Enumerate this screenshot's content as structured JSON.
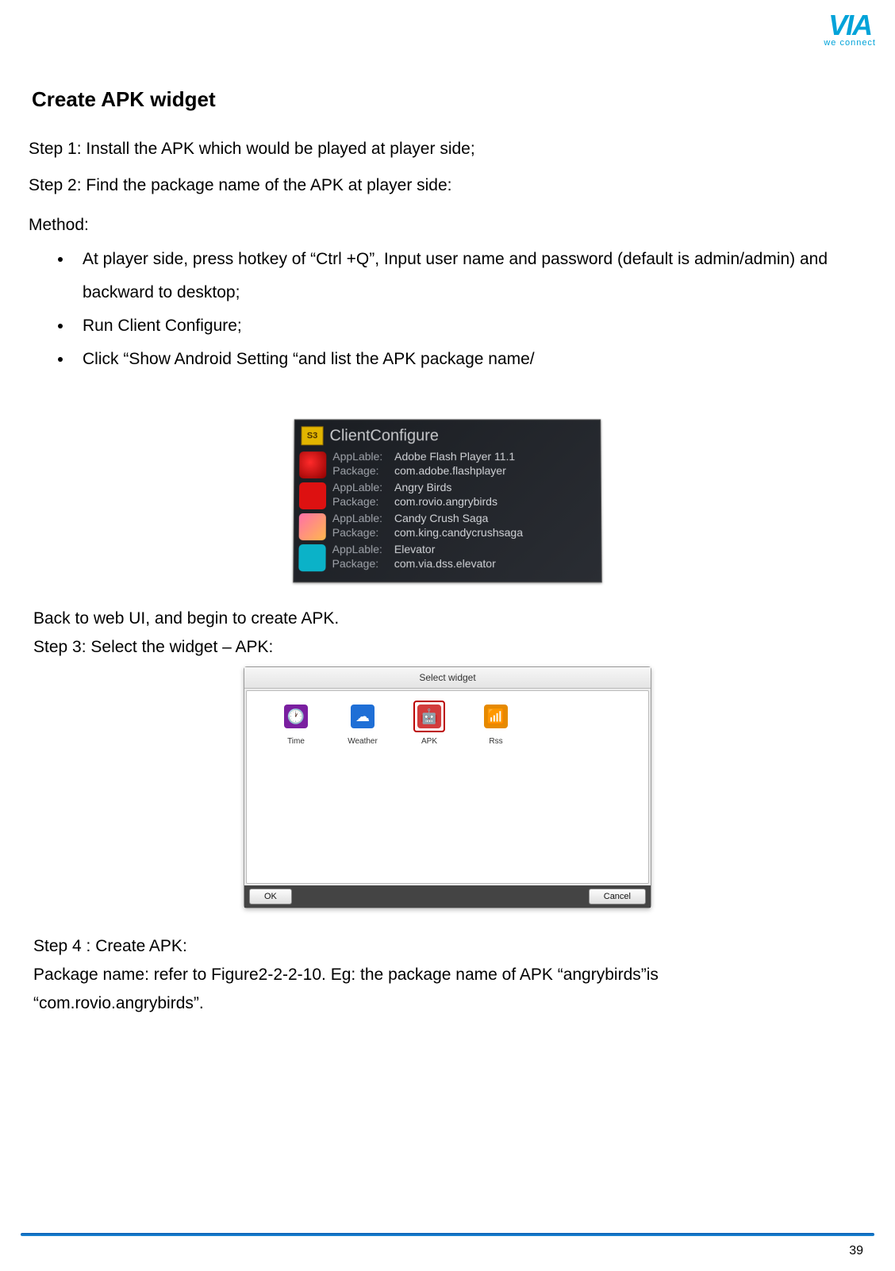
{
  "logo": {
    "main": "VIA",
    "sub": "we connect"
  },
  "heading": "Create APK widget",
  "step1": "Step 1: Install the APK which would be played at player side;",
  "step2": "Step 2: Find the package name of the APK at player side:",
  "method_label": "Method:",
  "bullets": [
    "At player side, press hotkey of “Ctrl +Q”, Input user name and password (default is admin/admin) and backward to desktop;",
    "Run Client Configure;",
    "Click “Show Android Setting “and list the APK package name/"
  ],
  "clientconfig": {
    "title": "ClientConfigure",
    "badge": "S3",
    "apps": [
      {
        "label_key": "AppLable:",
        "label": "Adobe Flash Player 11.1",
        "pkg_key": "Package:",
        "pkg": "com.adobe.flashplayer"
      },
      {
        "label_key": "AppLable:",
        "label": "Angry Birds",
        "pkg_key": "Package:",
        "pkg": "com.rovio.angrybirds"
      },
      {
        "label_key": "AppLable:",
        "label": "Candy Crush Saga",
        "pkg_key": "Package:",
        "pkg": "com.king.candycrushsaga"
      },
      {
        "label_key": "AppLable:",
        "label": "Elevator",
        "pkg_key": "Package:",
        "pkg": "com.via.dss.elevator"
      }
    ]
  },
  "after_fig1_a": "Back to web UI, and begin to create APK.",
  "after_fig1_b": "Step 3: Select the widget – APK:",
  "dialog": {
    "title": "Select widget",
    "widgets": [
      {
        "label": "Time"
      },
      {
        "label": "Weather"
      },
      {
        "label": "APK"
      },
      {
        "label": "Rss"
      }
    ],
    "ok": "OK",
    "cancel": "Cancel"
  },
  "step4_a": "Step 4 : Create APK:",
  "step4_b": "Package name: refer to Figure2-2-2-10. Eg: the package name of APK “angrybirds”is",
  "step4_c": "“com.rovio.angrybirds”.",
  "page_number": "39"
}
